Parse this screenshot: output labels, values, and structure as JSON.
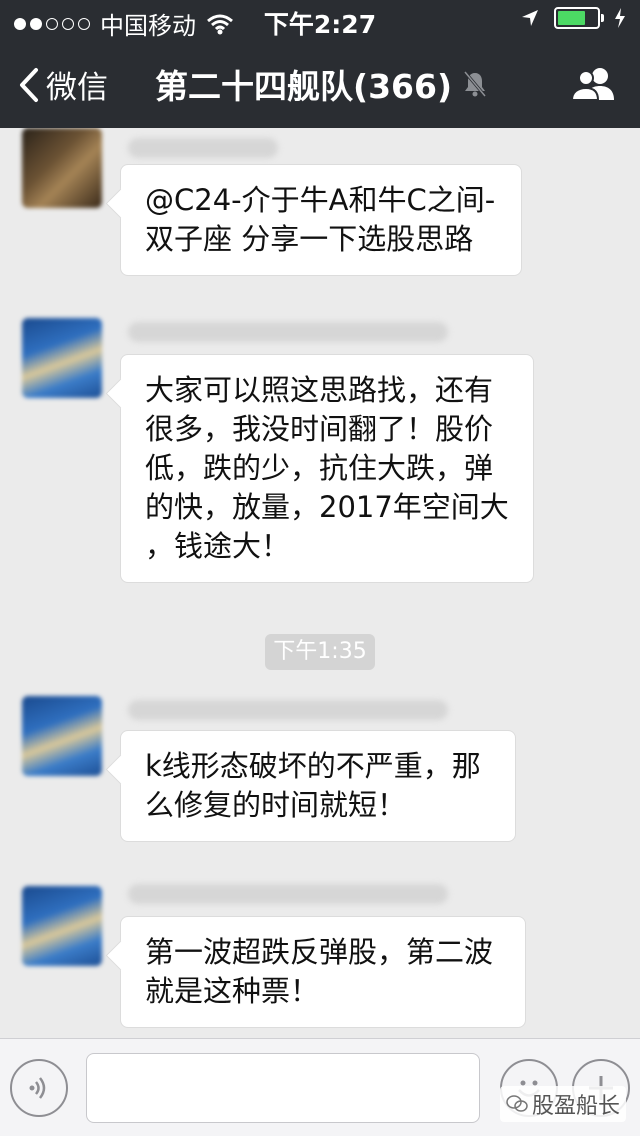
{
  "status_bar": {
    "carrier": "中国移动",
    "time": "下午2:27",
    "battery_level": 0.7
  },
  "nav": {
    "back_label": "微信",
    "title": "第二十四舰队(366)"
  },
  "messages": [
    {
      "lines": [
        "@C24-介于牛A和牛C之间-",
        "双子座 分享一下选股思路"
      ]
    },
    {
      "lines": [
        "大家可以照这思路找，还有",
        "很多，我没时间翻了！股价",
        "低，跌的少，抗住大跌，弹",
        "的快，放量，2017年空间大",
        "，钱途大！"
      ]
    },
    {
      "lines": [
        "k线形态破坏的不严重，那",
        "么修复的时间就短！"
      ]
    },
    {
      "lines": [
        "第一波超跌反弹股，第二波",
        "就是这种票！"
      ]
    }
  ],
  "timestamp": "下午1:35",
  "watermark": "股盈船长",
  "colors": {
    "nav_bg": "#2a2d32",
    "chat_bg": "#ebebeb",
    "battery_green": "#4cd964"
  }
}
